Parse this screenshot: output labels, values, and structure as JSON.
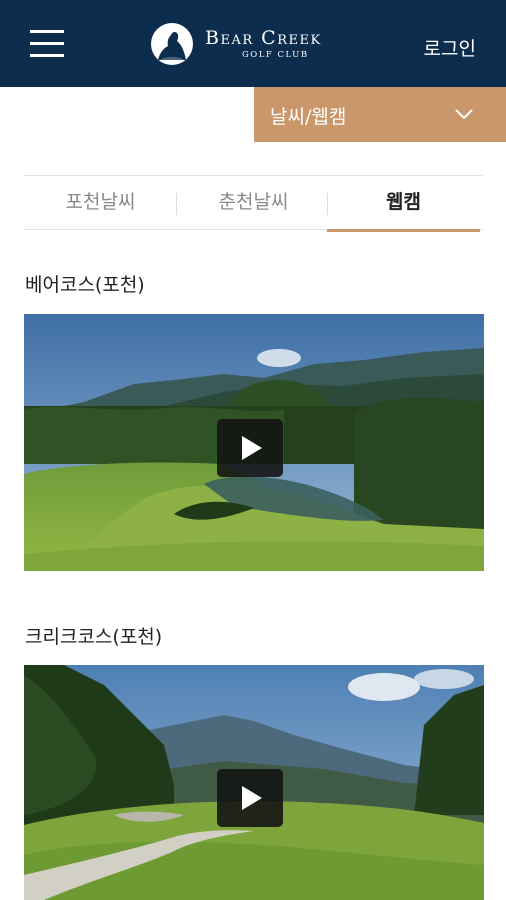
{
  "header": {
    "logo_title": "Bear Creek",
    "logo_subtitle": "GOLF CLUB",
    "login_label": "로그인"
  },
  "dropdown": {
    "label": "날씨/웹캠"
  },
  "tabs": [
    {
      "label": "포천날씨",
      "active": false
    },
    {
      "label": "춘천날씨",
      "active": false
    },
    {
      "label": "웹캠",
      "active": true
    }
  ],
  "webcams": [
    {
      "title": "베어코스(포천)"
    },
    {
      "title": "크리크코스(포천)"
    }
  ],
  "colors": {
    "header_bg": "#0d2d4e",
    "accent": "#c9976a"
  },
  "icons": {
    "menu": "hamburger-icon",
    "dropdown": "chevron-down-icon",
    "play": "play-icon",
    "logo": "bear-emblem-icon"
  }
}
